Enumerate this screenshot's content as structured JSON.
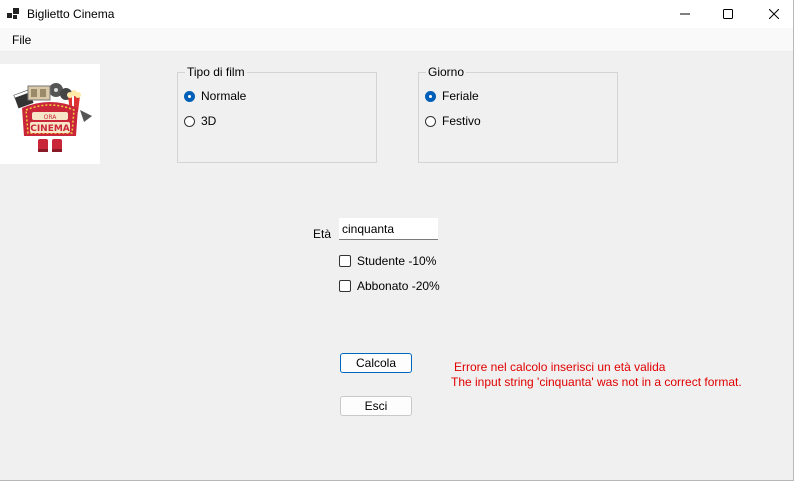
{
  "window": {
    "title": "Biglietto Cinema"
  },
  "menu": {
    "file": "File"
  },
  "logo": {
    "sign_text": "CINEMA",
    "marquee_text": "ORA"
  },
  "film_type": {
    "legend": "Tipo di film",
    "options": [
      {
        "label": "Normale",
        "checked": true
      },
      {
        "label": "3D",
        "checked": false
      }
    ]
  },
  "day": {
    "legend": "Giorno",
    "options": [
      {
        "label": "Feriale",
        "checked": true
      },
      {
        "label": "Festivo",
        "checked": false
      }
    ]
  },
  "age": {
    "label": "Età",
    "value": "cinquanta"
  },
  "discounts": {
    "student": {
      "label": "Studente -10%",
      "checked": false
    },
    "subscriber": {
      "label": "Abbonato -20%",
      "checked": false
    }
  },
  "buttons": {
    "calculate": "Calcola",
    "exit": "Esci"
  },
  "error": {
    "line1": "Errore nel calcolo inserisci un età valida",
    "line2": "The input string 'cinquanta' was not in a correct format."
  },
  "colors": {
    "accent": "#005fb8",
    "error": "#e00000"
  }
}
